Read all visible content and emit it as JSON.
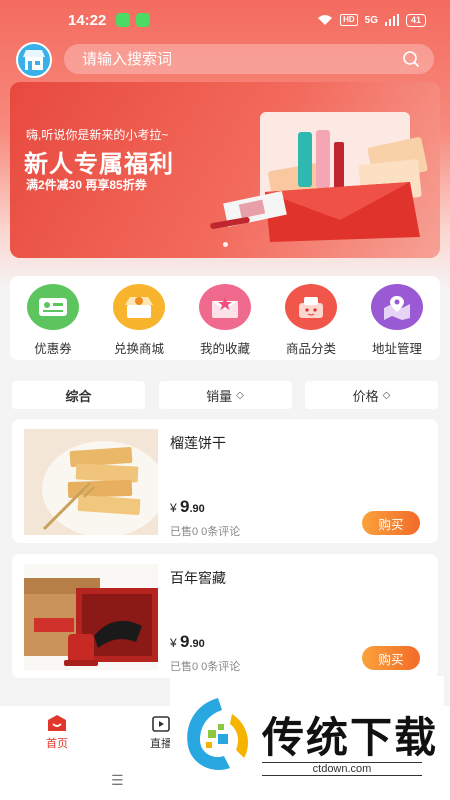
{
  "status_bar": {
    "time": "14:22",
    "network": "5G",
    "hd": "HD",
    "battery": "41"
  },
  "search": {
    "placeholder": "请输入搜索词"
  },
  "banner": {
    "greeting": "嗨,听说你是新来的小考拉~",
    "title": "新人专属福利",
    "subtitle": "满2件减30  再享85折券"
  },
  "quick_menu": [
    {
      "label": "优惠券",
      "icon": "coupon-icon",
      "color": "#5cc55d"
    },
    {
      "label": "兑换商城",
      "icon": "exchange-mall-icon",
      "color": "#f7b42c"
    },
    {
      "label": "我的收藏",
      "icon": "favorites-icon",
      "color": "#f06a8e"
    },
    {
      "label": "商品分类",
      "icon": "category-icon",
      "color": "#f0574a"
    },
    {
      "label": "地址管理",
      "icon": "location-icon",
      "color": "#9a5ad4"
    }
  ],
  "sort": {
    "comprehensive": "综合",
    "sales": "销量",
    "price": "价格"
  },
  "products": [
    {
      "name": "榴莲饼干",
      "currency": "¥",
      "price_int": "9",
      "price_dec": ".90",
      "stats": "已售0  0条评论",
      "buy": "购买"
    },
    {
      "name": "百年窖藏",
      "currency": "¥",
      "price_int": "9",
      "price_dec": ".90",
      "stats": "已售0  0条评论",
      "buy": "购买"
    }
  ],
  "bottom_nav": {
    "home": "首页",
    "live": "直播"
  },
  "watermark": {
    "text": "传统下载",
    "url": "ctdown.com"
  },
  "colors": {
    "accent": "#f0574a",
    "buy_start": "#f9a23b",
    "buy_end": "#f36b2a",
    "nav_active": "#e2372c"
  }
}
